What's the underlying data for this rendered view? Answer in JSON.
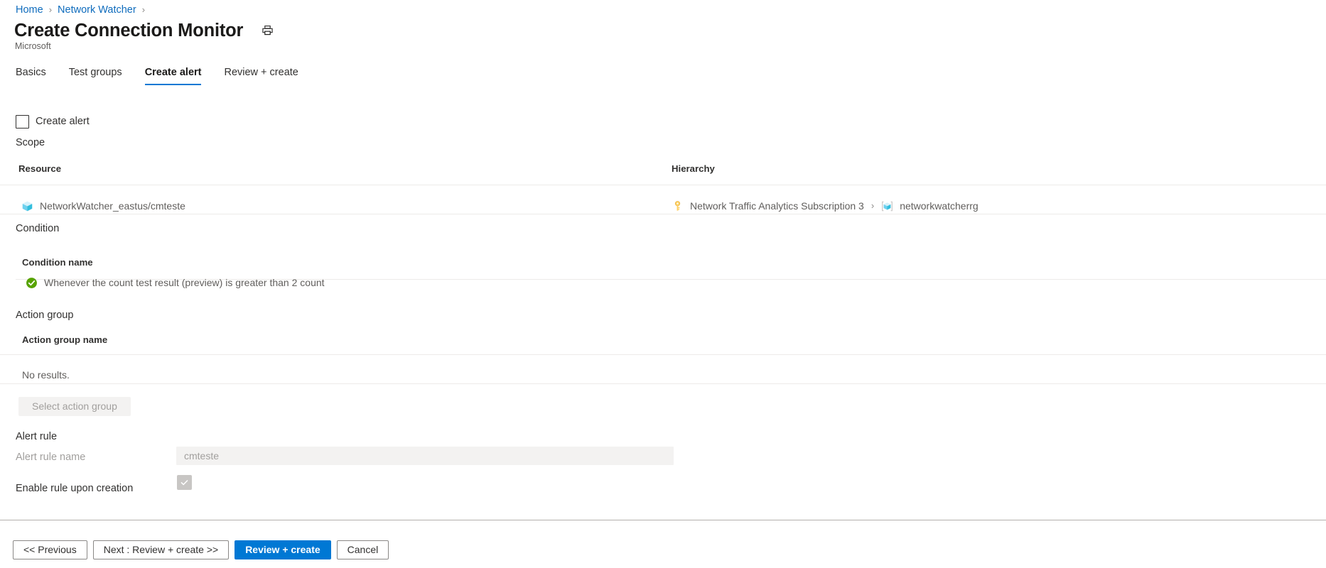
{
  "breadcrumb": {
    "items": [
      {
        "label": "Home"
      },
      {
        "label": "Network Watcher"
      }
    ],
    "separator": "›",
    "trailing_separator": "›"
  },
  "header": {
    "title": "Create Connection Monitor",
    "subtitle": "Microsoft",
    "print_icon": "printer-icon"
  },
  "tabs": [
    {
      "label": "Basics",
      "active": false
    },
    {
      "label": "Test groups",
      "active": false
    },
    {
      "label": "Create alert",
      "active": true
    },
    {
      "label": "Review + create",
      "active": false
    }
  ],
  "create_alert": {
    "label": "Create alert",
    "checked": false
  },
  "scope": {
    "heading": "Scope",
    "columns": [
      "Resource",
      "Hierarchy"
    ],
    "rows": [
      {
        "resource_icon": "resource-cube-icon",
        "resource": "NetworkWatcher_eastus/cmteste",
        "hierarchy": {
          "subscription_icon": "key-icon",
          "subscription": "Network Traffic Analytics Subscription 3",
          "separator": "›",
          "resource_group_icon": "resource-group-icon",
          "resource_group": "networkwatcherrg"
        }
      }
    ]
  },
  "condition": {
    "heading": "Condition",
    "column": "Condition name",
    "rows": [
      {
        "status_icon": "check-circle-icon",
        "status_color": "#57a300",
        "text": "Whenever the count test result (preview) is greater than 2 count"
      }
    ]
  },
  "action_group": {
    "heading": "Action group",
    "column": "Action group name",
    "empty_text": "No results.",
    "select_button": "Select action group"
  },
  "alert_rule": {
    "heading": "Alert rule",
    "name_label": "Alert rule name",
    "name_value": "cmteste",
    "name_placeholder": "",
    "enable_label": "Enable rule upon creation",
    "enable_checked": true
  },
  "footer": {
    "buttons": [
      {
        "label": "<< Previous",
        "primary": false
      },
      {
        "label": "Next : Review + create >>",
        "primary": false
      },
      {
        "label": "Review + create",
        "primary": true
      },
      {
        "label": "Cancel",
        "primary": false
      }
    ]
  },
  "colors": {
    "accent": "#0078d4",
    "link": "#0f6cbd",
    "success": "#57a300",
    "disabled_bg": "#f3f2f1",
    "disabled_text": "#a19f9d"
  }
}
